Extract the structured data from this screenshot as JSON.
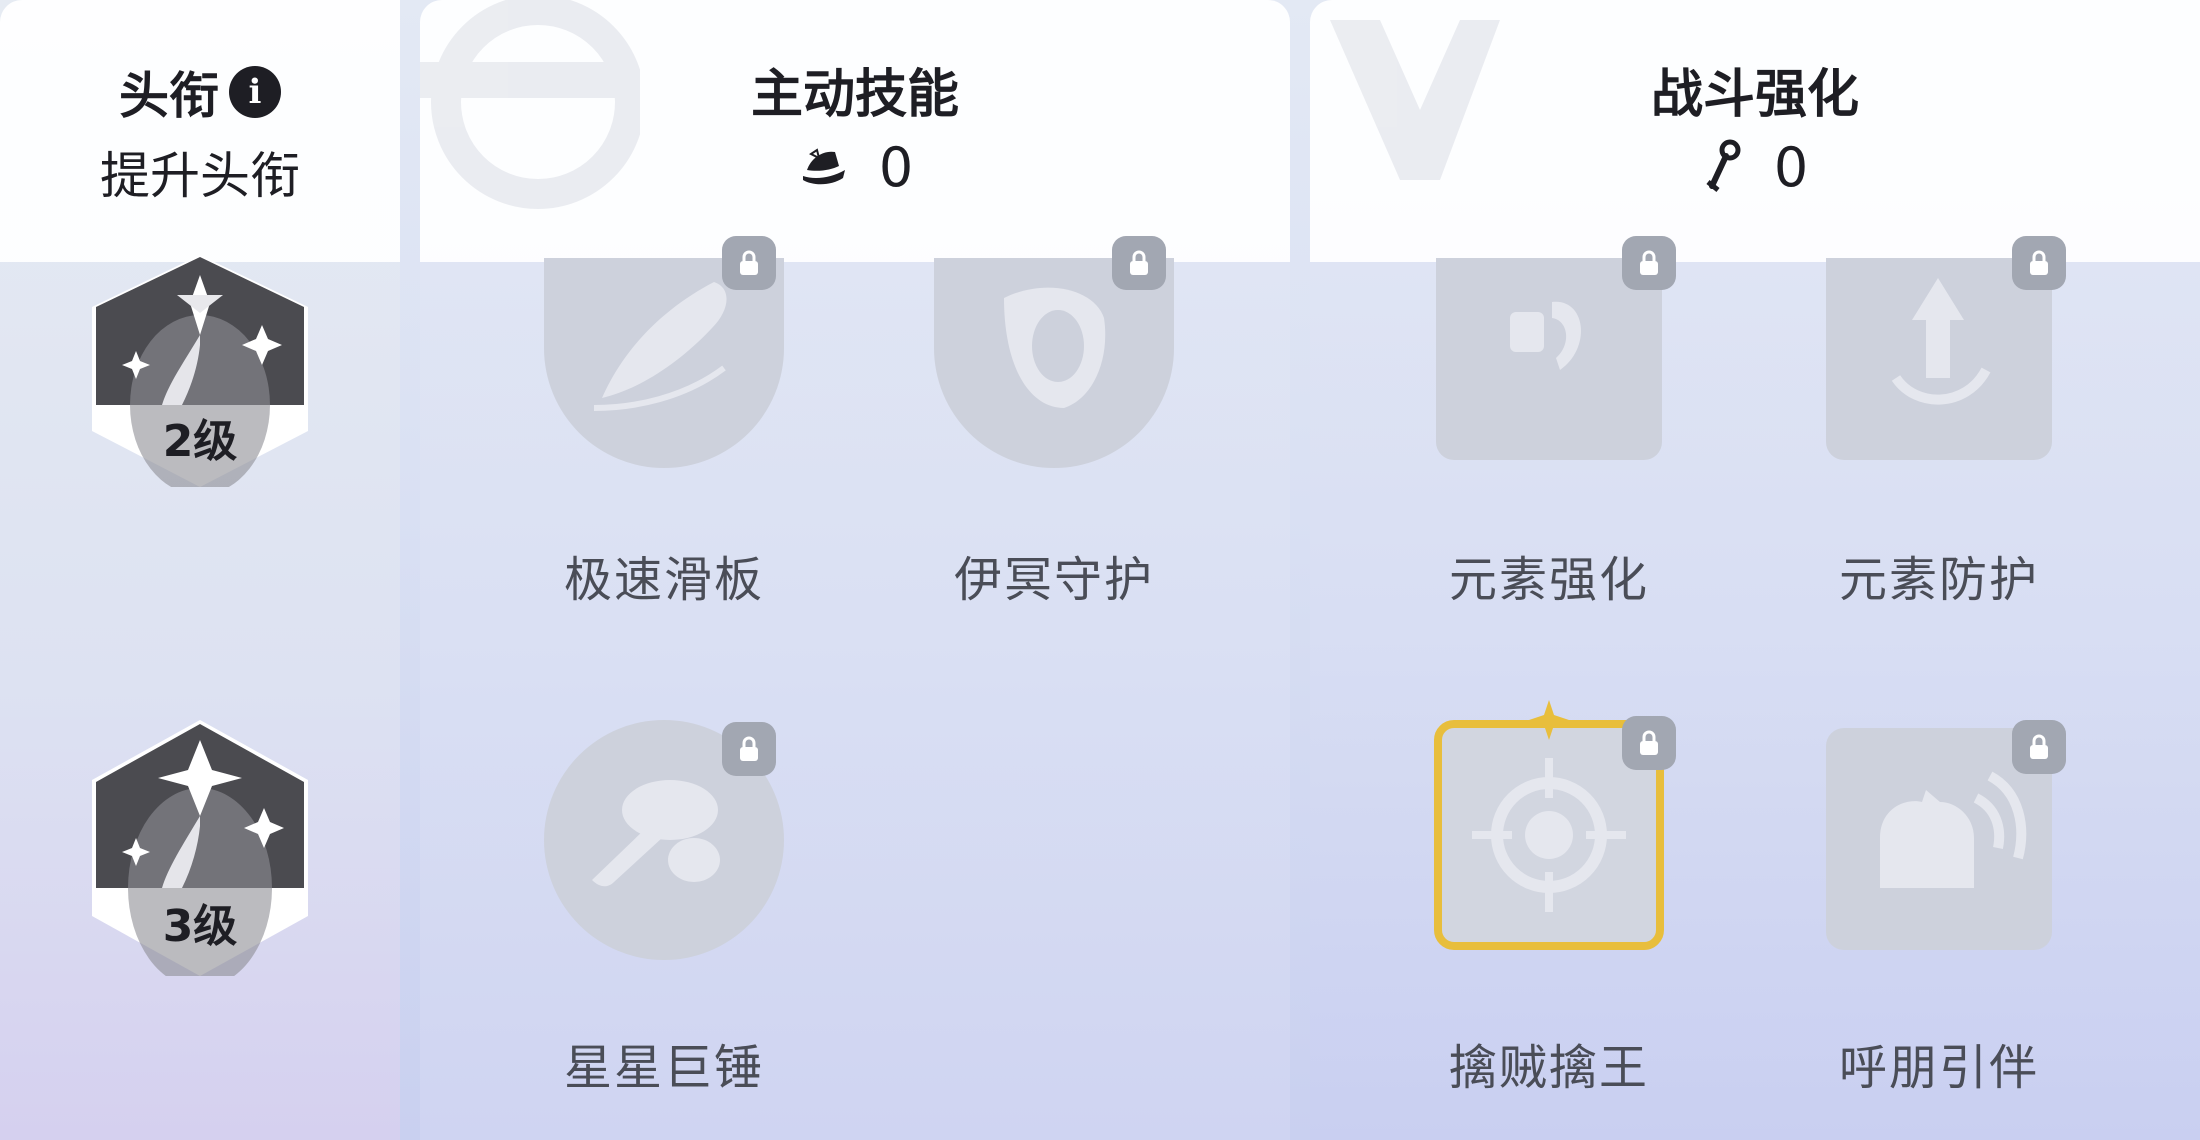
{
  "title_panel": {
    "title": "头衔",
    "info_icon": "info-icon",
    "subtitle": "提升头衔",
    "ranks": [
      {
        "label": "2级"
      },
      {
        "label": "3级"
      }
    ]
  },
  "active_panel": {
    "title": "主动技能",
    "resource_icon": "hat-icon",
    "count": "0",
    "skills": [
      {
        "name": "极速滑板",
        "icon": "feather-icon",
        "locked": true
      },
      {
        "name": "伊冥守护",
        "icon": "shield-icon",
        "locked": true
      },
      {
        "name": "星星巨锤",
        "icon": "hammer-icon",
        "locked": true
      }
    ]
  },
  "combat_panel": {
    "title": "战斗强化",
    "resource_icon": "wrench-icon",
    "count": "0",
    "skills": [
      {
        "name": "元素强化",
        "icon": "element-icon",
        "locked": true
      },
      {
        "name": "元素防护",
        "icon": "arrow-up-icon",
        "locked": true
      },
      {
        "name": "擒贼擒王",
        "icon": "target-icon",
        "locked": true,
        "highlighted": true
      },
      {
        "name": "呼朋引伴",
        "icon": "call-icon",
        "locked": true
      }
    ]
  },
  "colors": {
    "highlight_border": "#e8be3c",
    "lock_bg": "#a2a7b2",
    "tile_bg": "#cdd1dc"
  }
}
